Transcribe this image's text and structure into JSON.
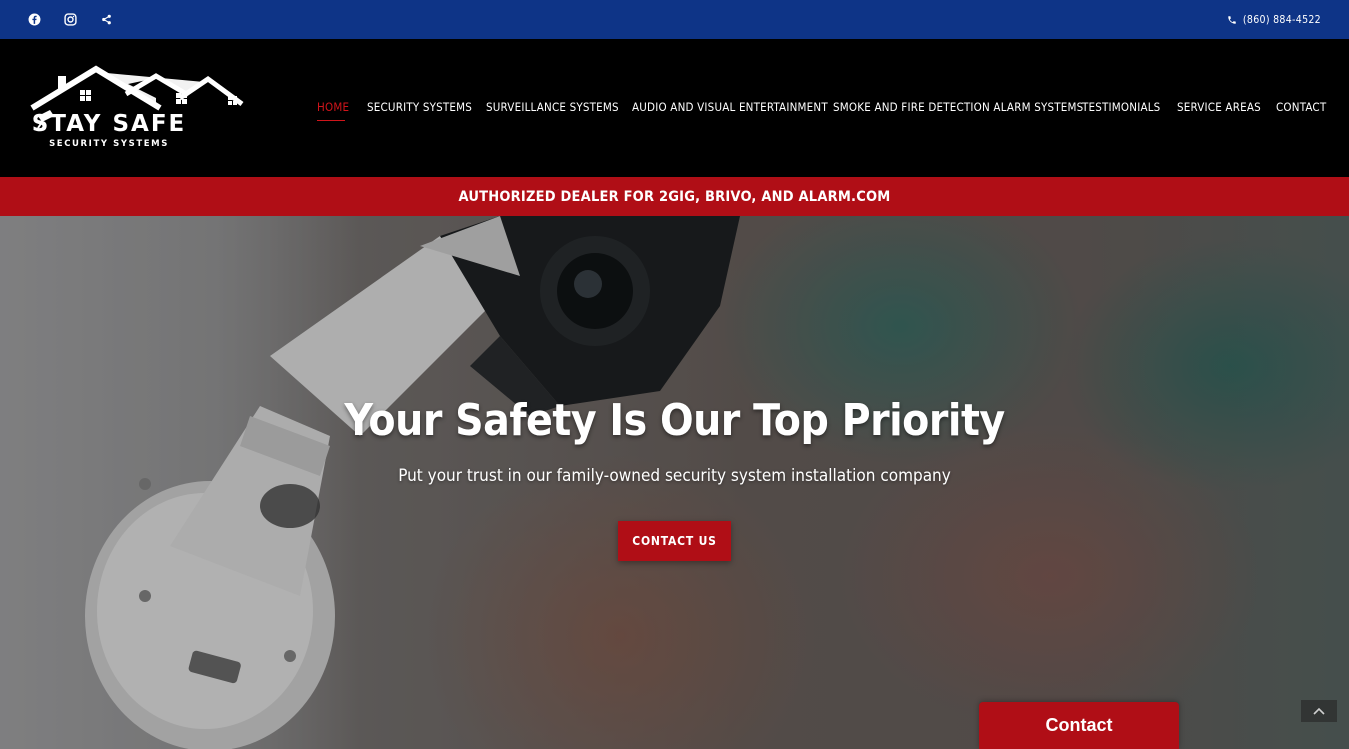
{
  "topbar": {
    "social_icons": [
      "facebook-icon",
      "instagram-icon",
      "share-icon"
    ],
    "phone": "(860) 884-4522",
    "bg_color": "#0e3487"
  },
  "logo": {
    "name": "STAY SAFE",
    "tagline": "SECURITY SYSTEMS"
  },
  "nav": {
    "items": [
      {
        "label": "HOME",
        "active": true
      },
      {
        "label": "SECURITY SYSTEMS",
        "active": false
      },
      {
        "label": "SURVEILLANCE SYSTEMS",
        "active": false
      },
      {
        "label": "AUDIO AND VISUAL ENTERTAINMENT",
        "active": false
      },
      {
        "label": "SMOKE AND FIRE DETECTION ALARM SYSTEMS",
        "active": false
      },
      {
        "label": "TESTIMONIALS",
        "active": false
      },
      {
        "label": "SERVICE AREAS",
        "active": false
      },
      {
        "label": "CONTACT",
        "active": false
      }
    ],
    "active_color": "#d0151b"
  },
  "banner": {
    "text": "AUTHORIZED DEALER FOR 2GIG, BRIVO, AND ALARM.COM",
    "bg_color": "#b00e16"
  },
  "hero": {
    "title": "Your Safety Is Our Top Priority",
    "subtitle": "Put your trust in our family-owned security system installation company",
    "button_label": "CONTACT US"
  },
  "floating_contact": {
    "label": "Contact"
  },
  "scroll_top": {
    "icon": "chevron-up-icon"
  }
}
